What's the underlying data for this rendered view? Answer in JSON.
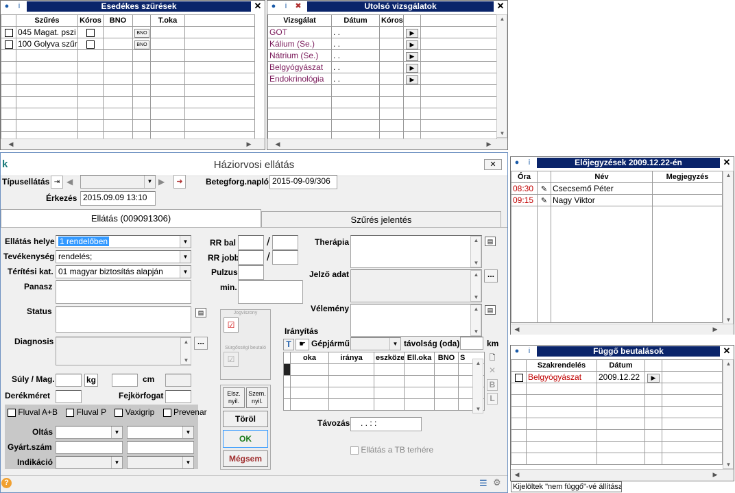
{
  "esed": {
    "title": "Esedékes szűrések",
    "columns": [
      "Szűrés",
      "Kóros",
      "BNO",
      "",
      "T.oka"
    ],
    "rows": [
      {
        "szures": "045 Magat. pszi",
        "bno_btn": "BNO"
      },
      {
        "szures": "100 Golyva szűr",
        "bno_btn": "BNO"
      }
    ]
  },
  "utolso": {
    "title": "Utolsó vizsgálatok",
    "columns": [
      "Vizsgálat",
      "Dátum",
      "Kóros",
      ""
    ],
    "rows": [
      {
        "vizsgalat": "GOT",
        "datum": ". ."
      },
      {
        "vizsgalat": "Kálium (Se.)",
        "datum": ". ."
      },
      {
        "vizsgalat": "Nátrium (Se.)",
        "datum": ". ."
      },
      {
        "vizsgalat": "Belgyógyászat",
        "datum": ". ."
      },
      {
        "vizsgalat": "Endokrinológia",
        "datum": ". ."
      }
    ],
    "link_color": "#7a1a5a"
  },
  "elojegy": {
    "title": "Előjegyzések 2009.12.22-én",
    "columns": [
      "Óra",
      "Név",
      "Megjegyzés"
    ],
    "rows": [
      {
        "ora": "08:30",
        "nev": "Csecsemő Péter"
      },
      {
        "ora": "09:15",
        "nev": "Nagy Viktor"
      }
    ],
    "time_color": "#c00000"
  },
  "fuggo": {
    "title": "Függő beutalások",
    "columns": [
      "",
      "Szakrendelés",
      "Dátum",
      ""
    ],
    "rows": [
      {
        "szak": "Belgyógyászat",
        "datum": "2009.12.22"
      }
    ],
    "status_text": "Kijelöltek \"nem függő\"-vé állítása"
  },
  "main": {
    "title": "Háziorvosi ellátás",
    "tipusellatas_label": "Típusellátás",
    "betegforg_label": "Betegforg.napló",
    "betegforg_value": "2015-09-09/306",
    "erkezes_label": "Érkezés",
    "erkezes_value": "2015.09.09 13:10",
    "tabs": [
      "Ellátás (009091306)",
      "Szűrés jelentés"
    ],
    "ellatas_helye_label": "Ellátás helye",
    "ellatas_helye_value": "1 rendelőben",
    "tevekenyseg_label": "Tevékenység",
    "tevekenyseg_value": "rendelés;",
    "teritesi_label": "Térítési kat.",
    "teritesi_value": "01 magyar biztosítás alapján",
    "panasz_label": "Panasz",
    "status_label": "Status",
    "diagnosis_label": "Diagnosis",
    "suly_label": "Súly / Mag.",
    "kg_label": "kg",
    "cm_label": "cm",
    "derek_label": "Derékméret",
    "fejkor_label": "Fejkörfogat",
    "vakcina": [
      "Fluval A+B",
      "Fluval P",
      "Vaxigrip",
      "Prevenar"
    ],
    "oltas_label": "Oltás",
    "gyart_label": "Gyárt.szám",
    "indikacio_label": "Indikáció",
    "rr_bal_label": "RR bal",
    "rr_jobb_label": "RR jobb",
    "pulzus_label": "Pulzus",
    "min_label": "min.",
    "slash": "/",
    "jogviszony_label": "Jogviszony",
    "surgossegi_label": "Sürgősségi beutaló",
    "elsz_label": "Elsz.\nnyil.",
    "szem_label": "Szem.\nnyil.",
    "torol_label": "Töröl",
    "ok_label": "OK",
    "megsem_label": "Mégsem",
    "terapia_label": "Therápia",
    "jelzo_label": "Jelző adat",
    "velemeny_label": "Vélemény",
    "iranyitas_label": "Irányítás",
    "t_btn": "T",
    "gepjarmu_label": "Gépjármű",
    "tavolsag_label": "távolság (oda)",
    "km_label": "km",
    "irany_columns": [
      "",
      "oka",
      "iránya",
      "eszköze",
      "Ell.oka",
      "BNO",
      "S"
    ],
    "side_btns": [
      "B",
      "L"
    ],
    "tavozas_label": "Távozás",
    "tavozas_value": ". .   : :",
    "ellatas_tb_label": "Ellátás a TB terhére",
    "ok_color": "#1a7a1a",
    "megsem_color": "#a03030"
  }
}
